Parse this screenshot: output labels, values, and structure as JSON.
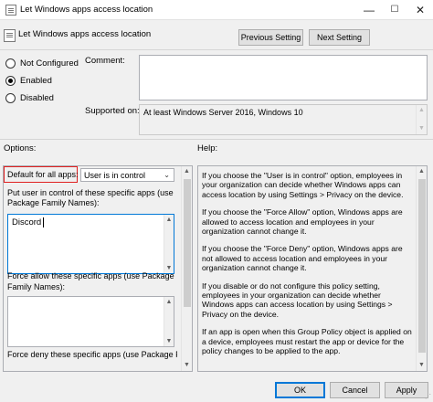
{
  "window": {
    "title": "Let Windows apps access location",
    "minimize": "—",
    "maximize": "☐",
    "close": "✕"
  },
  "header": {
    "title": "Let Windows apps access location",
    "prev_label": "Previous Setting",
    "next_label": "Next Setting"
  },
  "state": {
    "options": [
      {
        "label": "Not Configured",
        "selected": false
      },
      {
        "label": "Enabled",
        "selected": true
      },
      {
        "label": "Disabled",
        "selected": false
      }
    ]
  },
  "comment": {
    "label": "Comment:",
    "value": ""
  },
  "supported": {
    "label": "Supported on:",
    "value": "At least Windows Server 2016, Windows 10"
  },
  "options_panel": {
    "label": "Options:",
    "default_label": "Default for all apps:",
    "default_value": "User is in control",
    "user_control_label": "Put user in control of these specific apps (use Package Family Names):",
    "user_control_value": "Discord",
    "force_allow_label": "Force allow these specific apps (use Package Family Names):",
    "force_deny_label": "Force deny these specific apps (use Package Family"
  },
  "help_panel": {
    "label": "Help:",
    "paragraphs": [
      "If you choose the \"User is in control\" option, employees in your organization can decide whether Windows apps can access location by using Settings > Privacy on the device.",
      "If you choose the \"Force Allow\" option, Windows apps are allowed to access location and employees in your organization cannot change it.",
      "If you choose the \"Force Deny\" option, Windows apps are not allowed to access location and employees in your organization cannot change it.",
      "If you disable or do not configure this policy setting, employees in your organization can decide whether Windows apps can access location by using Settings > Privacy on the device.",
      "If an app is open when this Group Policy object is applied on a device, employees must restart the app or device for the policy changes to be applied to the app."
    ]
  },
  "footer": {
    "ok": "OK",
    "cancel": "Cancel",
    "apply": "Apply"
  },
  "colors": {
    "highlight_box": "#e02020",
    "accent": "#0078d7"
  }
}
